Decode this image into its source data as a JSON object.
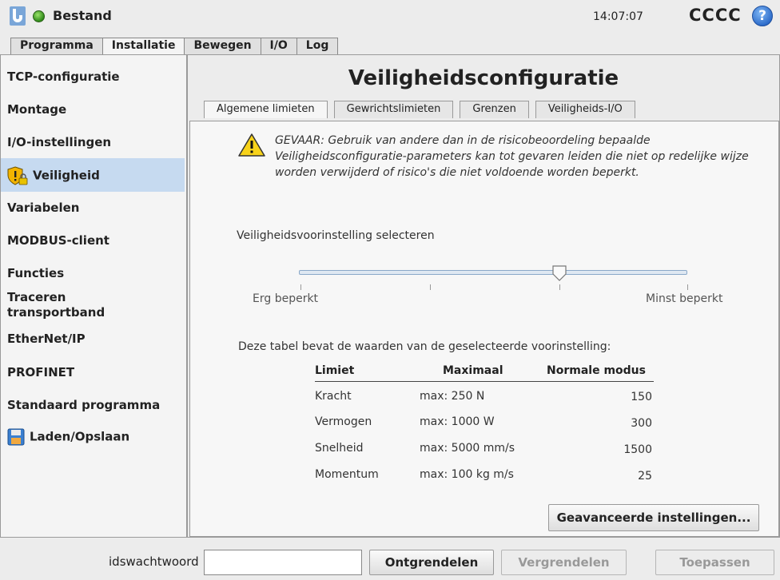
{
  "header": {
    "app_title": "Bestand",
    "clock": "14:07:07",
    "robot_name": "CCCC",
    "help_symbol": "?",
    "logo_icon": "ur-logo-icon",
    "status_color": "#2f8a1a"
  },
  "main_tabs": [
    {
      "label": "Programma"
    },
    {
      "label": "Installatie"
    },
    {
      "label": "Bewegen"
    },
    {
      "label": "I/O"
    },
    {
      "label": "Log"
    }
  ],
  "sidebar": {
    "items": [
      {
        "label": "TCP-configuratie"
      },
      {
        "label": "Montage"
      },
      {
        "label": "I/O-instellingen"
      },
      {
        "label": "Veiligheid"
      },
      {
        "label": "Variabelen"
      },
      {
        "label": "MODBUS-client"
      },
      {
        "label": "Functies"
      },
      {
        "label": "Traceren transportband"
      },
      {
        "label": "EtherNet/IP"
      },
      {
        "label": "PROFINET"
      },
      {
        "label": "Standaard programma"
      },
      {
        "label": "Laden/Opslaan"
      }
    ],
    "active_color": "#c6daf0"
  },
  "content": {
    "title": "Veiligheidsconfiguratie",
    "tabs": [
      {
        "label": "Algemene limieten"
      },
      {
        "label": "Gewrichtslimieten"
      },
      {
        "label": "Grenzen"
      },
      {
        "label": "Veiligheids-I/O"
      }
    ],
    "warning": "GEVAAR: Gebruik van andere dan in de risicobeoordeling bepaalde Veiligheidsconfiguratie-parameters kan tot gevaren leiden die niet op redelijke wijze worden verwijderd of risico's die niet voldoende worden beperkt.",
    "preset_label": "Veiligheidsvoorinstelling selecteren",
    "slider": {
      "min_label": "Erg beperkt",
      "max_label": "Minst beperkt",
      "position": 0.67
    },
    "table_caption": "Deze tabel bevat de waarden van de geselecteerde voorinstelling:",
    "table": {
      "headers": [
        "Limiet",
        "Maximaal",
        "Normale modus"
      ],
      "rows": [
        [
          "Kracht",
          "max: 250 N",
          "150"
        ],
        [
          "Vermogen",
          "max: 1000 W",
          "300"
        ],
        [
          "Snelheid",
          "max: 5000 mm/s",
          "1500"
        ],
        [
          "Momentum",
          "max: 100 kg m/s",
          "25"
        ]
      ]
    },
    "advanced_button": "Geavanceerde instellingen..."
  },
  "bottom": {
    "password_label": "idswachtwoord",
    "password_value": "",
    "unlock": "Ontgrendelen",
    "lock": "Vergrendelen",
    "apply": "Toepassen"
  }
}
